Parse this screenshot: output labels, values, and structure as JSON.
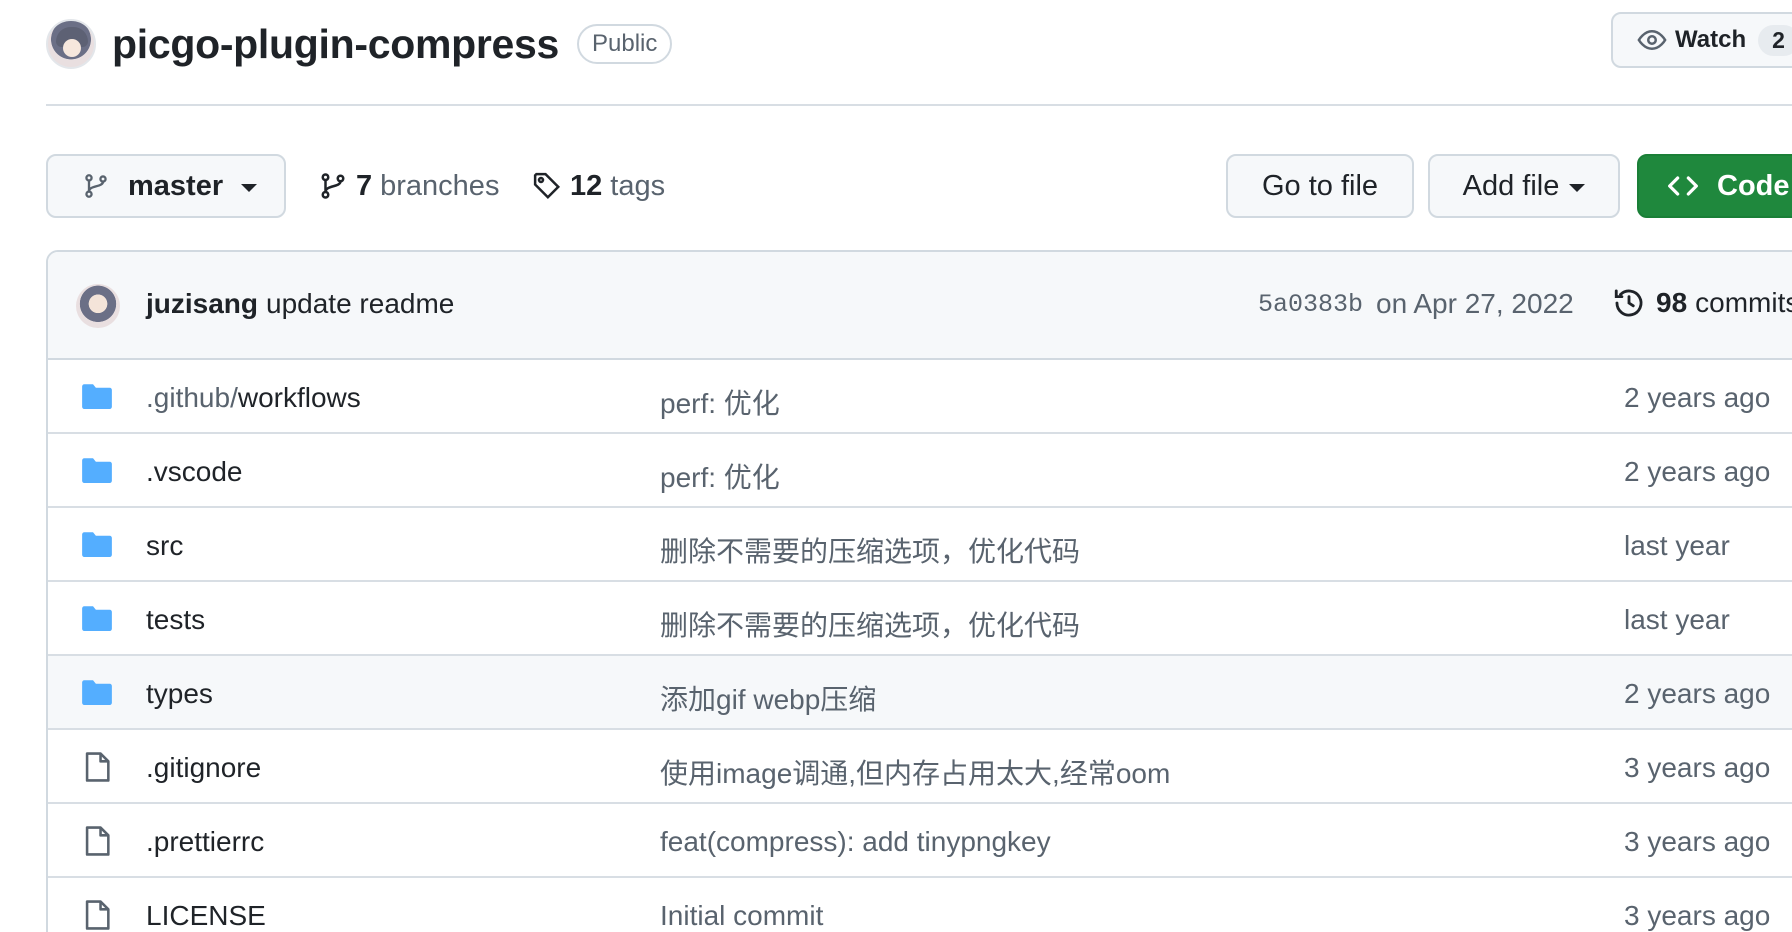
{
  "repo": {
    "name": "picgo-plugin-compress",
    "visibility": "Public",
    "watch_label": "Watch",
    "watch_count": "2"
  },
  "toolbar": {
    "branch": "master",
    "branches_count": "7",
    "branches_label": "branches",
    "tags_count": "12",
    "tags_label": "tags",
    "goto_label": "Go to file",
    "addfile_label": "Add file",
    "code_label": "Code"
  },
  "latest_commit": {
    "author": "juzisang",
    "message": "update readme",
    "sha": "5a0383b",
    "date": "on Apr 27, 2022",
    "count": "98",
    "count_label": "commits"
  },
  "files": [
    {
      "type": "dir",
      "prefix": ".github/",
      "name": "workflows",
      "message": "perf: 优化",
      "age": "2 years ago"
    },
    {
      "type": "dir",
      "prefix": "",
      "name": ".vscode",
      "message": "perf: 优化",
      "age": "2 years ago"
    },
    {
      "type": "dir",
      "prefix": "",
      "name": "src",
      "message": "删除不需要的压缩选项，优化代码",
      "age": "last year"
    },
    {
      "type": "dir",
      "prefix": "",
      "name": "tests",
      "message": "删除不需要的压缩选项，优化代码",
      "age": "last year"
    },
    {
      "type": "dir",
      "prefix": "",
      "name": "types",
      "message": "添加gif webp压缩",
      "age": "2 years ago"
    },
    {
      "type": "file",
      "prefix": "",
      "name": ".gitignore",
      "message": "使用image调通,但内存占用太大,经常oom",
      "age": "3 years ago"
    },
    {
      "type": "file",
      "prefix": "",
      "name": ".prettierrc",
      "message": "feat(compress): add tinypngkey",
      "age": "3 years ago"
    },
    {
      "type": "file",
      "prefix": "",
      "name": "LICENSE",
      "message": "Initial commit",
      "age": "3 years ago"
    }
  ],
  "colors": {
    "folder": "#54aeff",
    "code_button": "#1f883d"
  }
}
